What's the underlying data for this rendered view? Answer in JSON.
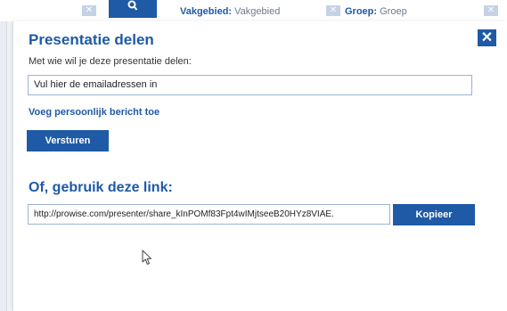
{
  "background": {
    "search_icon": "search-icon",
    "filters": [
      {
        "label": "Vakgebied:",
        "value": "Vakgebied"
      },
      {
        "label": "Groep:",
        "value": "Groep"
      }
    ]
  },
  "modal": {
    "title": "Presentatie delen",
    "close_icon": "close-icon",
    "close_label": "✕",
    "question": "Met wie wil je deze presentatie delen:",
    "email_value": "Vul hier de emailadressen in",
    "add_message_link": "Voeg persoonlijk bericht toe",
    "send_button": "Versturen",
    "link_heading": "Of, gebruik deze link:",
    "share_link": "http://prowise.com/presenter/share_kInPOMf83Fpt4wIMjtseeB20HYz8VIAE.",
    "copy_button": "Kopieer"
  },
  "colors": {
    "accent": "#1f5aa6",
    "input_border": "#9bb3d3",
    "text": "#333333"
  }
}
